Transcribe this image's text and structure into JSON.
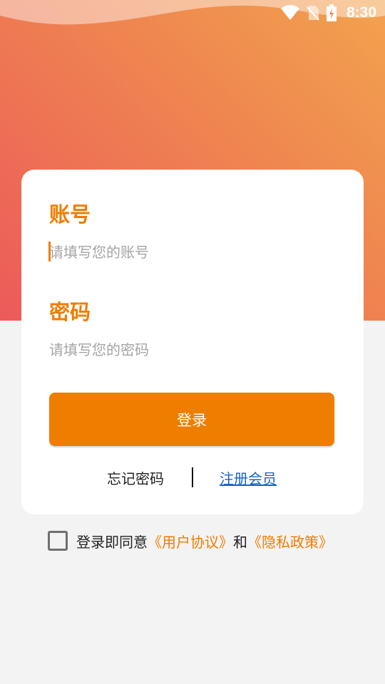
{
  "status_bar": {
    "time": "8:30",
    "icons": [
      "wifi-icon",
      "no-sim-icon",
      "battery-charging-icon"
    ]
  },
  "colors": {
    "accent": "#ef7d00",
    "gradient_start": "#f2a24e",
    "gradient_end": "#ec5a5a",
    "link": "#1a63c8",
    "background": "#f3f3f3"
  },
  "login_form": {
    "account_label": "账号",
    "account_placeholder": "请填写您的账号",
    "account_value": "",
    "password_label": "密码",
    "password_placeholder": "请填写您的密码",
    "password_value": "",
    "login_button": "登录",
    "forgot_password": "忘记密码",
    "register": "注册会员"
  },
  "agreement": {
    "checked": false,
    "prefix": "登录即同意",
    "user_agreement": "《用户协议》",
    "conjunction": "和",
    "privacy_policy": "《隐私政策》"
  }
}
